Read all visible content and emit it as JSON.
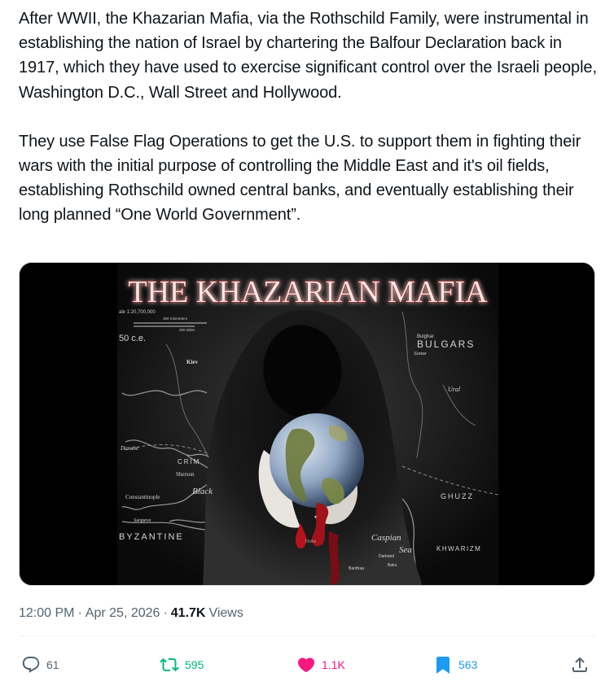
{
  "post": {
    "paragraphs": [
      "After WWII, the Khazarian Mafia, via the Rothschild Family, were instrumental in establishing the nation of Israel by chartering the Balfour Declaration back in 1917, which they have used to exercise significant control over the Israeli people, Washington D.C., Wall Street and Hollywood.",
      "They use False Flag Operations to get the U.S. to support them in fighting their wars with the initial purpose of controlling the Middle East and it's oil fields, establishing Rothschild owned central banks, and eventually establishing their long planned “One World Government”."
    ]
  },
  "media": {
    "title": "THE KHAZARIAN MAFIA",
    "scale_label": "ale 1:20,700,000",
    "scale_km": "300 Kilometers",
    "scale_mi": "300 Miles",
    "era": "50 c.e.",
    "map_labels": {
      "bulghar": "Bulghar",
      "bulgars": "BULGARS",
      "suwar": "Suwar",
      "kiev": "Kiev",
      "ural": "Ural",
      "crimea": "CRIM",
      "sherson": "Sherson",
      "constantinople": "Constantinople",
      "black": "Black",
      "sangarus": "Sangarus",
      "byzantine": "BYZANTINE",
      "ghuzz": "GHUZZ",
      "caspian": "Caspian",
      "sea": "Sea",
      "khwarizm": "KHWARIZM",
      "tbilisi": "Tbilisi",
      "darband": "Darband",
      "baku": "Baku",
      "bardhaa": "Bardhaa",
      "danube": "Danube"
    }
  },
  "meta": {
    "time": "12:00 PM",
    "separator": "·",
    "date": "Apr 25, 2026",
    "views_count": "41.7K",
    "views_label": "Views"
  },
  "actions": {
    "replies": "61",
    "reposts": "595",
    "likes": "1.1K",
    "bookmarks": "563"
  },
  "colors": {
    "text": "#0f1419",
    "secondary": "#536471",
    "repost": "#00ba7c",
    "like": "#f91880",
    "bookmark": "#1d9bf0",
    "title_red": "#d8d0cc"
  },
  "icons": [
    "reply-icon",
    "retweet-icon",
    "heart-icon",
    "bookmark-icon",
    "share-icon"
  ]
}
